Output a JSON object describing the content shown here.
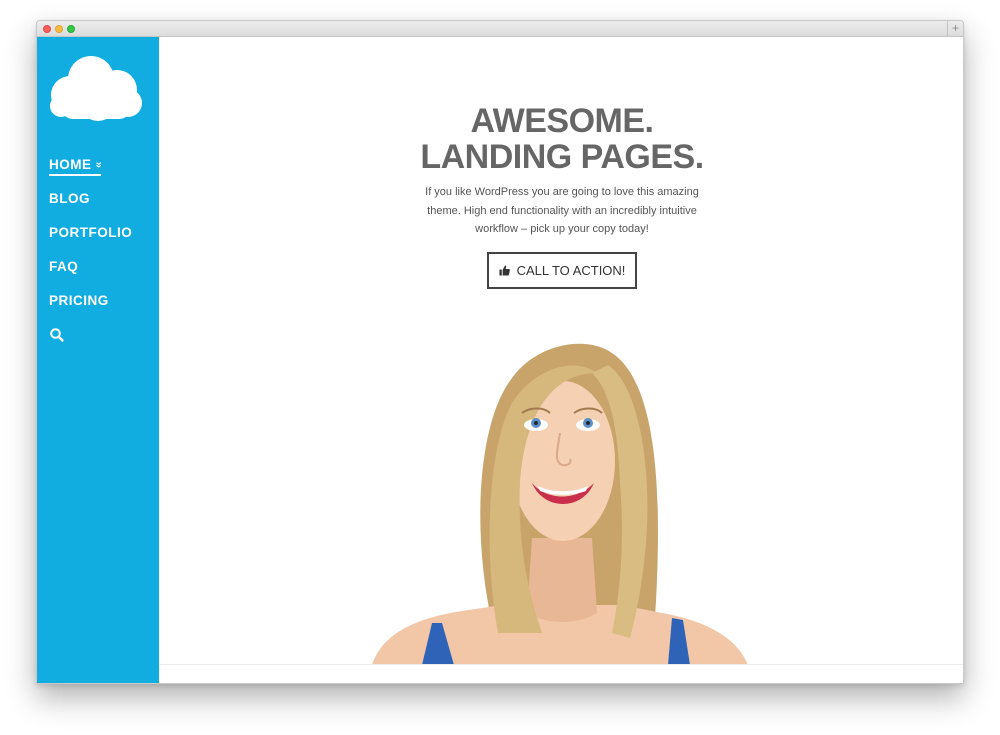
{
  "window": {
    "controls": [
      "close",
      "minimize",
      "zoom"
    ],
    "new_tab_label": "+"
  },
  "sidebar": {
    "logo_icon": "cloud-logo-icon",
    "bg_color": "#12ade0",
    "nav": [
      {
        "label": "HOME",
        "active": true,
        "icon": "double-chevron-down-icon",
        "icon_glyph": "»"
      },
      {
        "label": "BLOG"
      },
      {
        "label": "PORTFOLIO"
      },
      {
        "label": "FAQ"
      },
      {
        "label": "PRICING"
      }
    ],
    "search_icon": "search-icon"
  },
  "hero": {
    "title_line1": "AWESOME.",
    "title_line2": "LANDING PAGES.",
    "text_line1": "If you like WordPress you are going to love this amazing",
    "text_line2": "theme. High end functionality with an incredibly intuitive",
    "text_line3": "workflow – pick up your copy today!",
    "cta_label": "CALL TO ACTION!",
    "cta_icon": "thumbs-up-icon",
    "image": "woman-smiling-looking-up-photo"
  },
  "colors": {
    "accent": "#12ade0",
    "title": "#666666",
    "text": "#555555",
    "button_border": "#444444"
  }
}
